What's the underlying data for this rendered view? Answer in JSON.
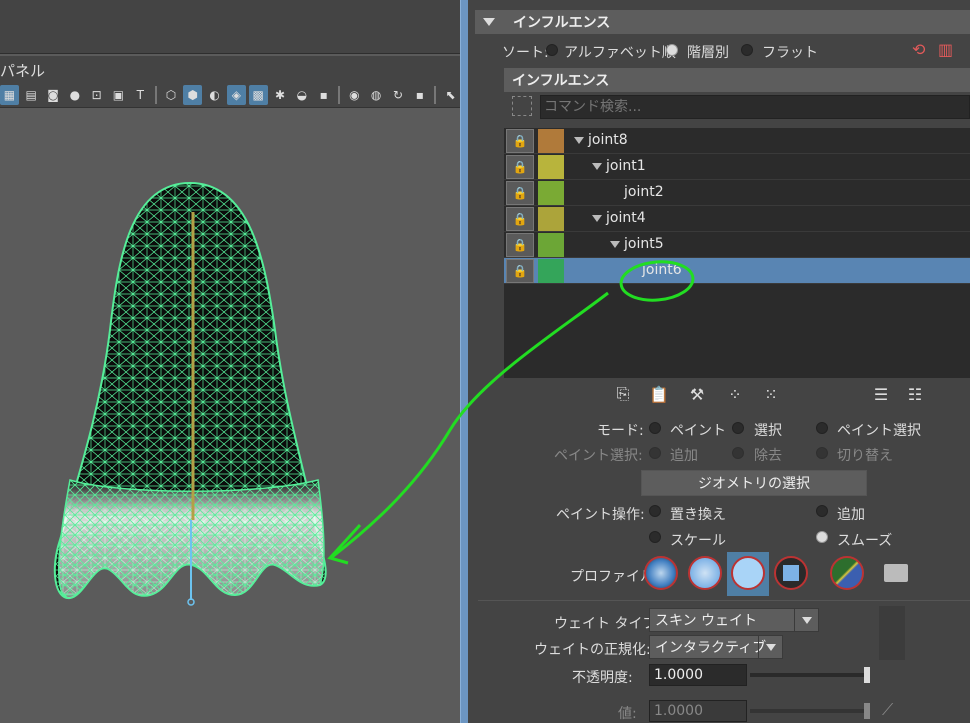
{
  "viewport": {
    "panel_menu": "パネル",
    "toolbar_icons": [
      "grid-icon",
      "film-icon",
      "camera-icon",
      "shadow-icon",
      "resolution-gate-icon",
      "image-plane-icon",
      "text-icon",
      "wireframe-cube-icon",
      "shaded-cube-icon",
      "textured-icon",
      "smooth-icon",
      "light-icon",
      "shadow-toggle-icon",
      "ao-icon",
      "motion-blur-icon",
      "aa-icon",
      "isolate-icon",
      "xray-icon",
      "xray-joints-icon",
      "select-icon"
    ]
  },
  "influence_section": {
    "title": "インフルエンス",
    "sort_label": "ソート:",
    "sort_options": [
      "アルファベット順",
      "階層別",
      "フラット"
    ],
    "sort_selected": 1,
    "list_title": "インフルエンス",
    "search_placeholder": "コマンド検索..."
  },
  "joints": [
    {
      "name": "joint8",
      "color": "#b07a3a",
      "level": 0,
      "expandable": true,
      "selected": false
    },
    {
      "name": "joint1",
      "color": "#b8b43c",
      "level": 1,
      "expandable": true,
      "selected": false
    },
    {
      "name": "joint2",
      "color": "#7aaa34",
      "level": 2,
      "expandable": false,
      "selected": false
    },
    {
      "name": "joint4",
      "color": "#aca43a",
      "level": 1,
      "expandable": true,
      "selected": false
    },
    {
      "name": "joint5",
      "color": "#6ca636",
      "level": 2,
      "expandable": true,
      "selected": false
    },
    {
      "name": "joint6",
      "color": "#34a55a",
      "level": 3,
      "expandable": false,
      "selected": true
    }
  ],
  "mode": {
    "label": "モード:",
    "options": [
      "ペイント",
      "選択",
      "ペイント選択"
    ],
    "selected": 0
  },
  "paint_select": {
    "label": "ペイント選択:",
    "options": [
      "追加",
      "除去",
      "切り替え"
    ]
  },
  "geometry_button": "ジオメトリの選択",
  "paint_op": {
    "label": "ペイント操作:",
    "options": [
      "置き換え",
      "追加",
      "スケール",
      "スムーズ"
    ],
    "selected": 3
  },
  "profile": {
    "label": "プロファイル:"
  },
  "weight_type": {
    "label": "ウェイト タイプ:",
    "value": "スキン ウェイト"
  },
  "normalize": {
    "label": "ウェイトの正規化:",
    "value": "インタラクティブ"
  },
  "opacity": {
    "label": "不透明度:",
    "value": "1.0000",
    "level": 1.0
  },
  "value": {
    "label": "値:",
    "value": "1.0000",
    "level": 1.0
  },
  "colors": {
    "annotation": "#22dd22",
    "selection": "#5985b3",
    "wireframe": "#55ee99"
  }
}
